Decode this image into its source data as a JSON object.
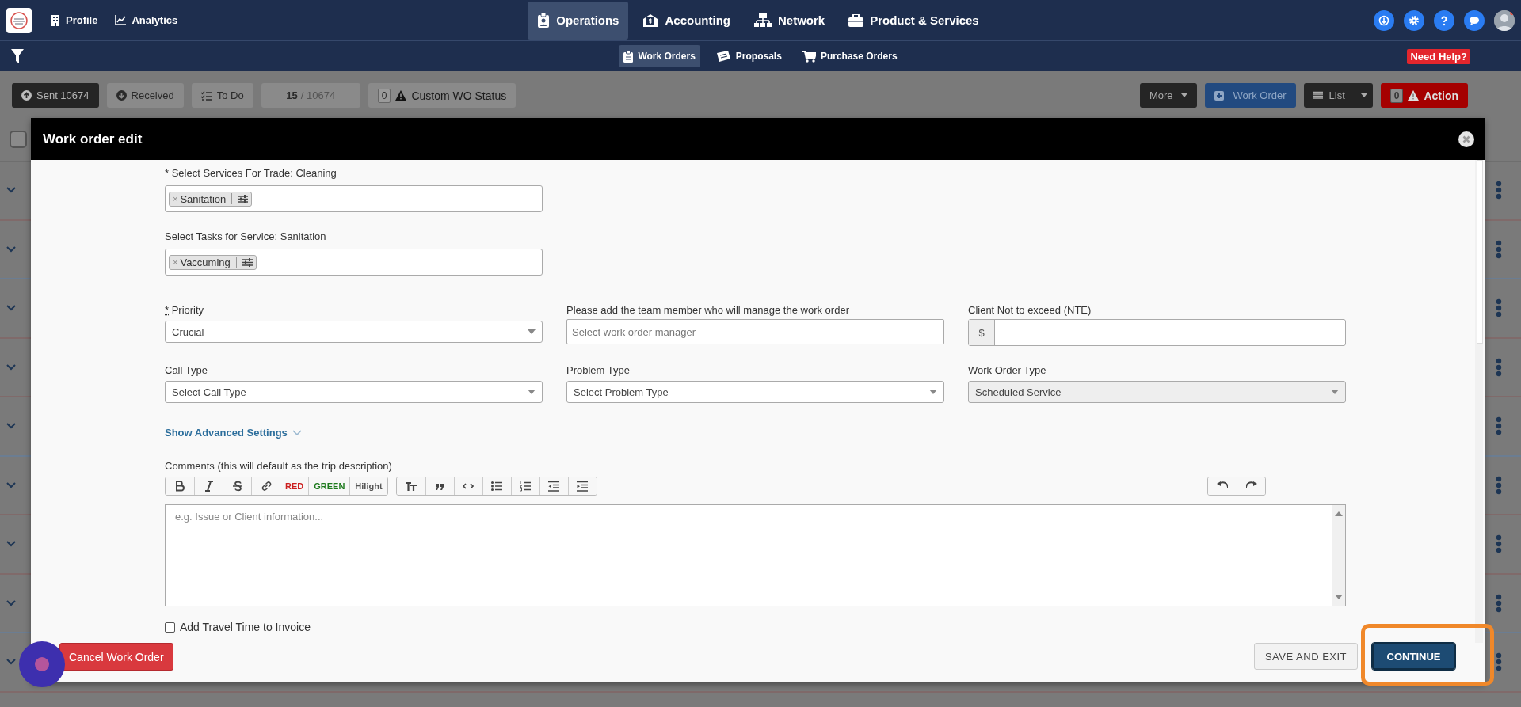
{
  "top_nav": {
    "links": [
      {
        "label": "Profile"
      },
      {
        "label": "Analytics"
      }
    ],
    "modules": [
      {
        "label": "Operations",
        "selected": true
      },
      {
        "label": "Accounting",
        "selected": false
      },
      {
        "label": "Network",
        "selected": false
      },
      {
        "label": "Product & Services",
        "selected": false
      }
    ]
  },
  "sub_nav": {
    "items": [
      {
        "label": "Work Orders",
        "selected": true
      },
      {
        "label": "Proposals",
        "selected": false
      },
      {
        "label": "Purchase Orders",
        "selected": false
      }
    ],
    "help": "Need Help?"
  },
  "toolbar": {
    "filters": [
      {
        "label": "Sent 10674",
        "selected": true
      },
      {
        "label": "Received",
        "selected": false
      },
      {
        "label": "To Do",
        "selected": false
      }
    ],
    "page": {
      "current": "15",
      "total": "/ 10674"
    },
    "status": {
      "count": "0",
      "label": "Custom WO Status"
    },
    "more": "More",
    "create": "Work Order",
    "view": "List",
    "action": {
      "count": "0",
      "label": "Action"
    }
  },
  "list": {
    "select_all": {
      "checked": false
    }
  },
  "modal": {
    "title": "Work order edit",
    "services": {
      "label": "* Select Services For Trade: Cleaning",
      "tags": [
        {
          "remove": "×",
          "label": "Sanitation"
        }
      ]
    },
    "tasks": {
      "label": "Select Tasks for Service: Sanitation",
      "tags": [
        {
          "remove": "×",
          "label": "Vaccuming"
        }
      ]
    },
    "fields": [
      {
        "kind": "select",
        "marker": "*",
        "label": "Priority",
        "value": "Crucial",
        "disabled": false
      },
      {
        "kind": "input",
        "label": "Please add the team member who will manage the work order",
        "placeholder": "Select work order manager",
        "disabled": false
      },
      {
        "kind": "money",
        "label": "Client Not to exceed (NTE)",
        "prefix": "$",
        "disabled": false
      },
      {
        "kind": "select",
        "label": "Call Type",
        "value": "Select Call Type",
        "disabled": false
      },
      {
        "kind": "select",
        "label": "Problem Type",
        "value": "Select Problem Type",
        "disabled": false
      },
      {
        "kind": "select",
        "label": "Work Order Type",
        "value": "Scheduled Service",
        "disabled": true
      }
    ],
    "advanced": {
      "label": "Show Advanced Settings",
      "expanded": false
    },
    "comments": {
      "label": "Comments (this will default as the trip description)",
      "color_buttons": [
        {
          "label": "RED",
          "color": "#cc1f1f"
        },
        {
          "label": "GREEN",
          "color": "#1d7a1d"
        },
        {
          "label": "Hilight",
          "color": "#555555"
        }
      ],
      "placeholder": "e.g. Issue or Client information..."
    },
    "travel": {
      "label": "Add Travel Time to Invoice",
      "checked": false
    },
    "cancel": "Cancel Work Order",
    "save": "SAVE AND EXIT",
    "continue": "CONTINUE"
  }
}
